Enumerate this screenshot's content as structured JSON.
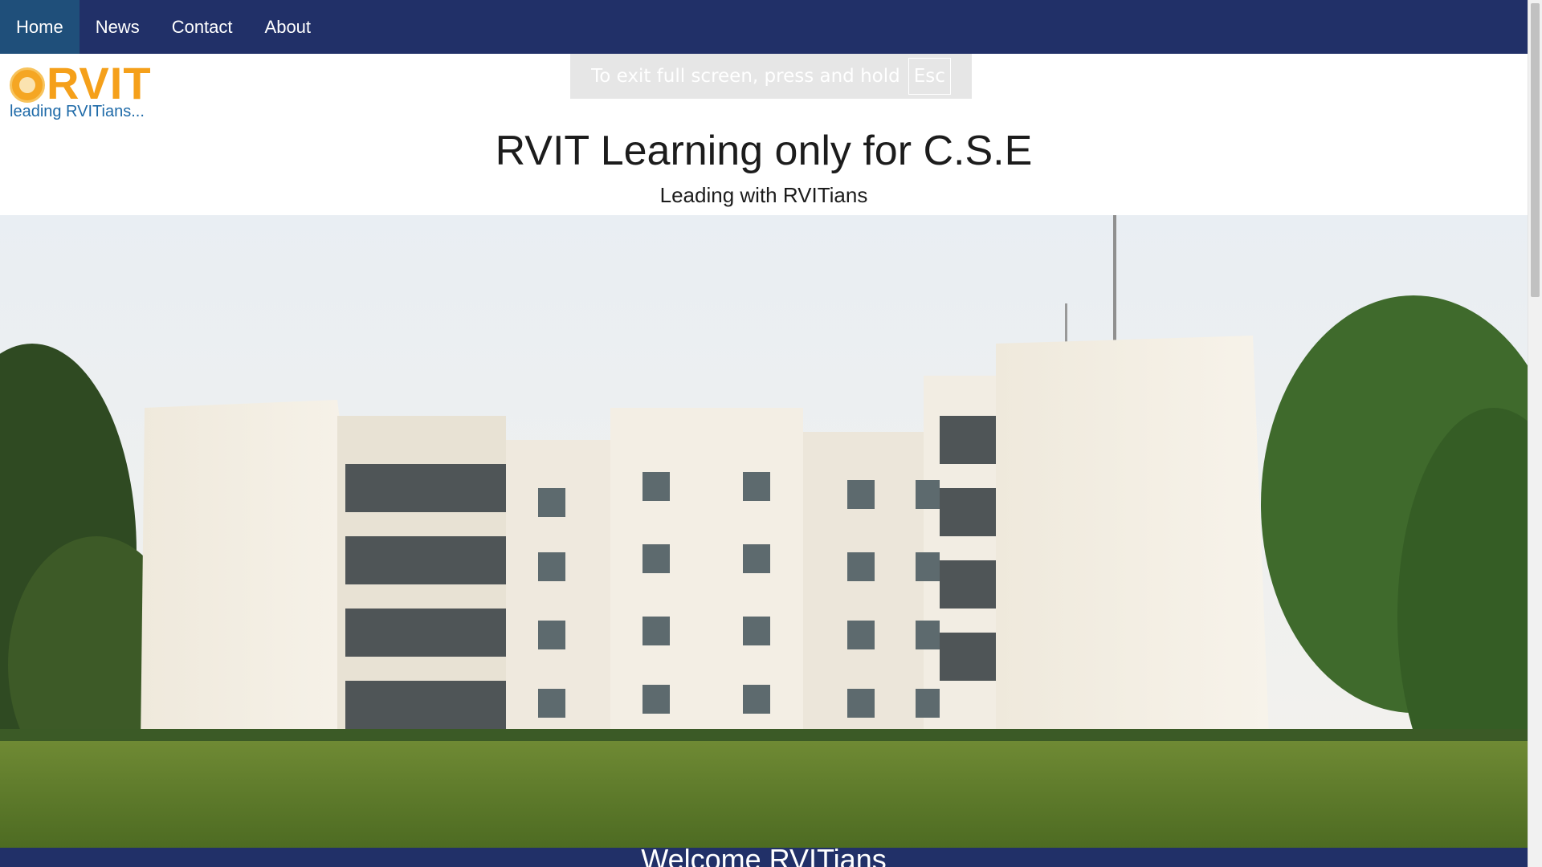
{
  "nav": {
    "items": [
      {
        "label": "Home",
        "active": true
      },
      {
        "label": "News",
        "active": false
      },
      {
        "label": "Contact",
        "active": false
      },
      {
        "label": "About",
        "active": false
      }
    ]
  },
  "fullscreen_notice": {
    "message": "To exit full screen, press and hold",
    "key": "Esc"
  },
  "header": {
    "logo_text": "RVIT",
    "logo_tagline": "leading RVITians...",
    "title": "RVIT Learning only for C.S.E",
    "subtitle": "Leading with RVITians"
  },
  "hero": {
    "image_icon": "campus-building-photo"
  },
  "welcome": {
    "text": "Welcome RVITians"
  },
  "colors": {
    "nav_bg": "#213068",
    "nav_active": "#1f4f7a",
    "logo_orange": "#f5a01a",
    "logo_blue": "#1e6aa8"
  }
}
